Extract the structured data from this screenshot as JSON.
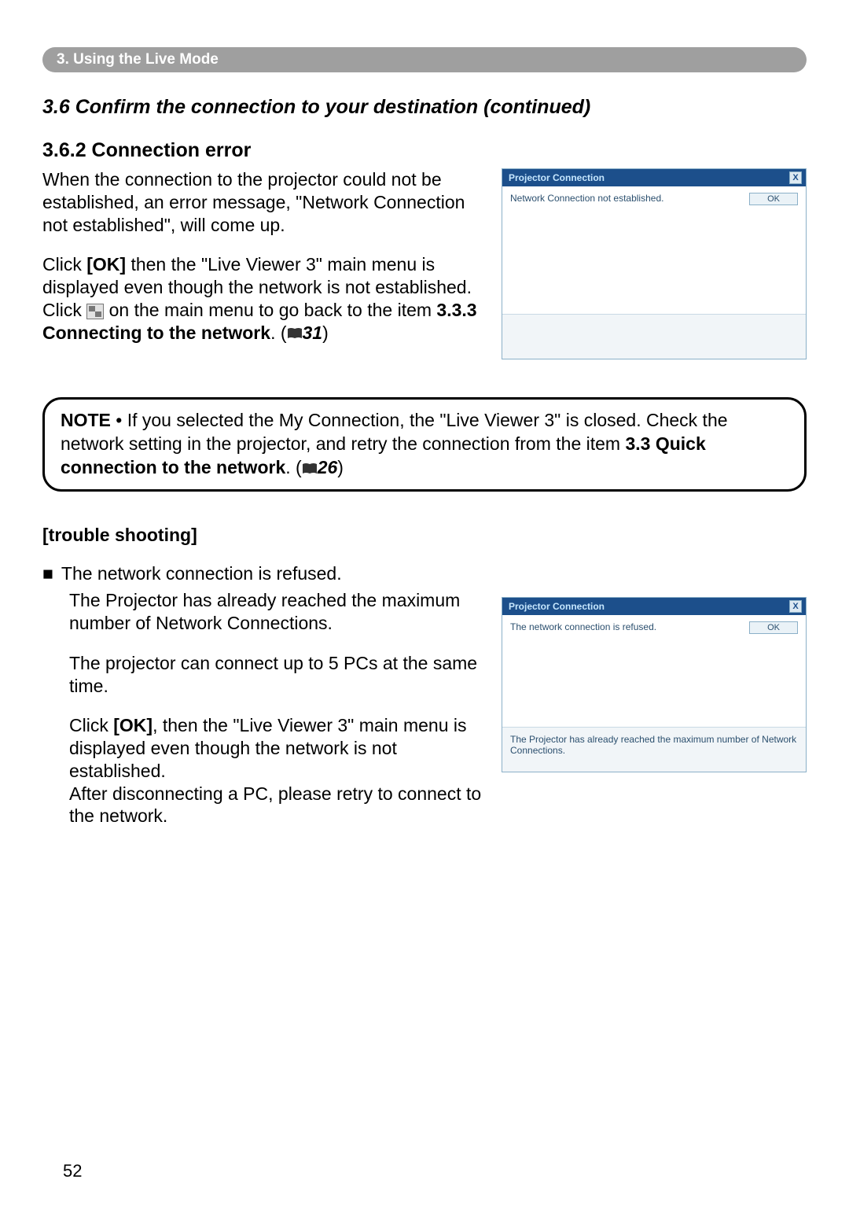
{
  "chapter": {
    "label": "3. Using the Live Mode"
  },
  "section": {
    "title": "3.6 Confirm the connection to your destination (continued)"
  },
  "subsection": {
    "title": "3.6.2 Connection error"
  },
  "para1": "When the connection to the projector could not be established, an error message, \"Network Connection not established\", will come up.",
  "para2_a": "Click ",
  "para2_ok": "[OK]",
  "para2_b": " then the \"Live Viewer 3\" main menu is displayed even though the network is not established. Click ",
  "para2_c": " on the main menu to go back to the item ",
  "para2_ref": "3.3.3 Connecting to the network",
  "para2_d": ". (",
  "para2_page": "31",
  "para2_e": ")",
  "dialog1": {
    "title": "Projector Connection",
    "message": "Network Connection not established.",
    "ok": "OK",
    "close": "X"
  },
  "note": {
    "label": "NOTE",
    "text_a": " • If you selected the My Connection, the \"Live Viewer 3\" is closed. Check the network setting in the projector, and retry the connection from the item ",
    "ref": "3.3 Quick connection to the network",
    "text_b": ". (",
    "page": "26",
    "text_c": ")"
  },
  "trouble": {
    "title": "[trouble shooting]",
    "bullet": "The network connection is refused.",
    "p1": "The Projector has already reached the maximum number of Network Connections.",
    "p2": "The projector can connect up to 5 PCs at the same time.",
    "p3_a": "Click ",
    "p3_ok": "[OK]",
    "p3_b": ", then the \"Live Viewer 3\" main menu is displayed even though the network is not established.",
    "p4": "After disconnecting a PC, please retry to connect to the network."
  },
  "dialog2": {
    "title": "Projector Connection",
    "message": "The network connection is refused.",
    "footer": "The Projector has already reached the maximum number of Network Connections.",
    "ok": "OK",
    "close": "X"
  },
  "pageNumber": "52"
}
